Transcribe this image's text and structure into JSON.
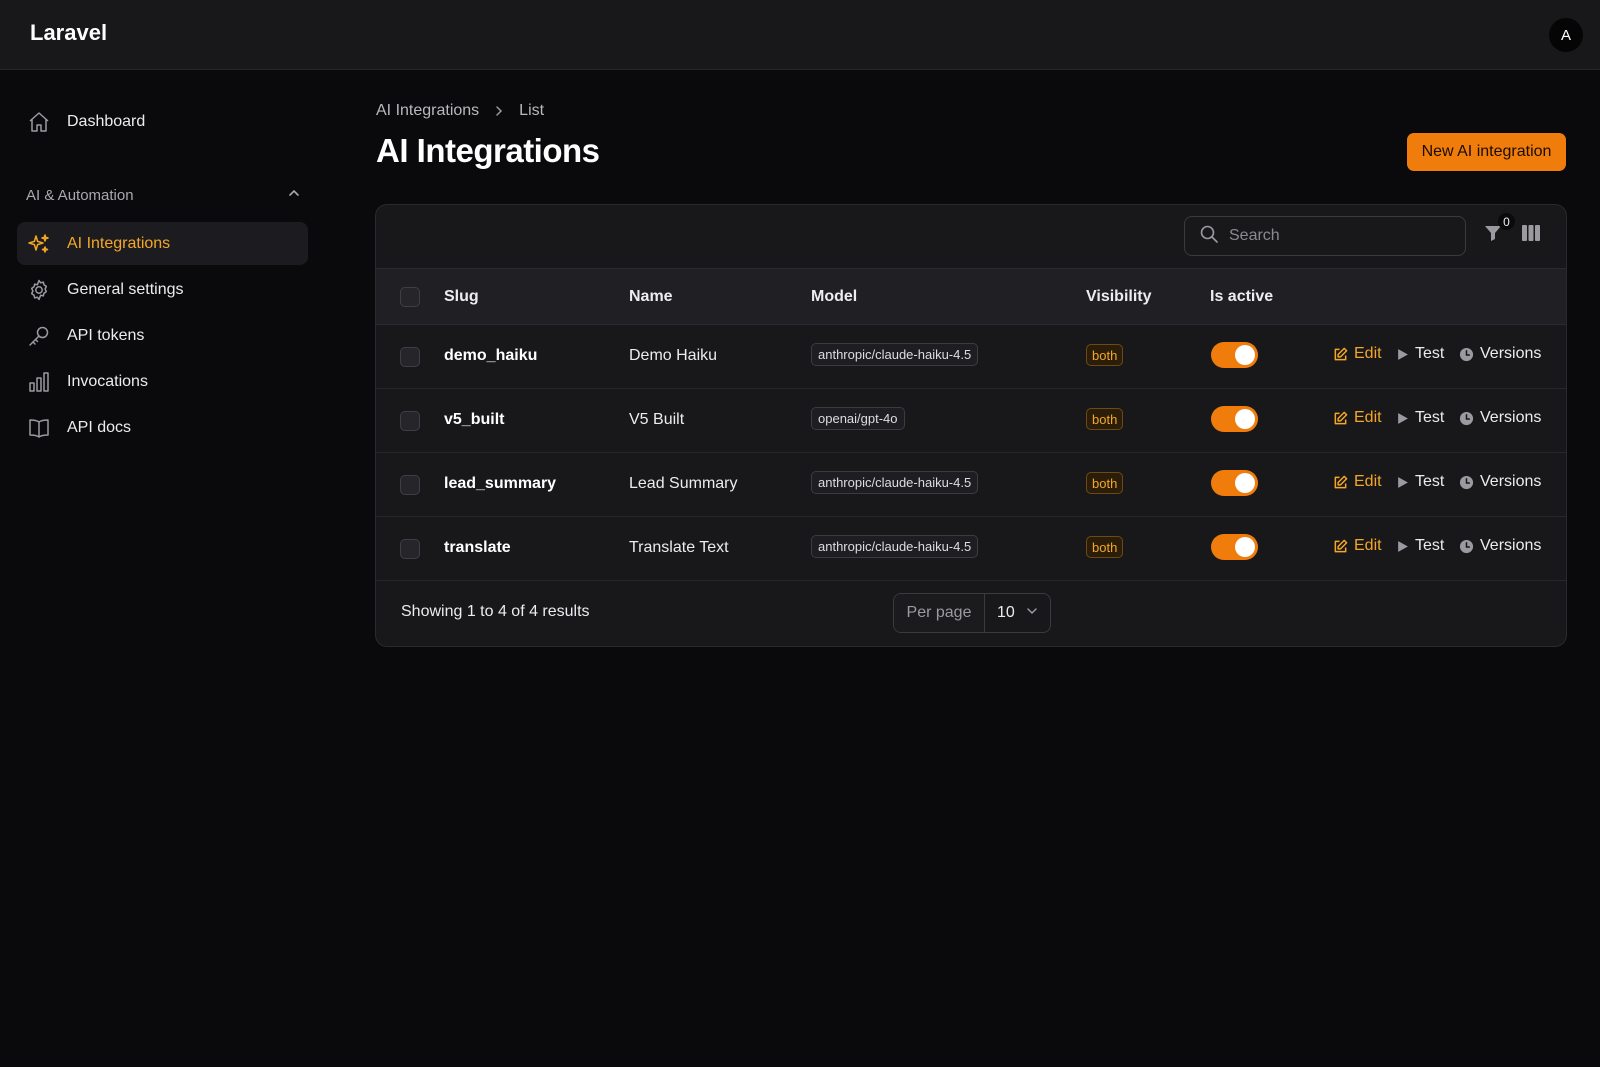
{
  "app": {
    "brand": "Laravel",
    "user_initial": "A"
  },
  "sidebar": {
    "dashboard": "Dashboard",
    "group_label": "AI & Automation",
    "items": [
      {
        "label": "AI Integrations",
        "icon": "sparkles-icon",
        "active": true
      },
      {
        "label": "General settings",
        "icon": "gear-icon",
        "active": false
      },
      {
        "label": "API tokens",
        "icon": "key-icon",
        "active": false
      },
      {
        "label": "Invocations",
        "icon": "bar-chart-icon",
        "active": false
      },
      {
        "label": "API docs",
        "icon": "book-open-icon",
        "active": false
      }
    ]
  },
  "breadcrumb": {
    "parent": "AI Integrations",
    "current": "List"
  },
  "page": {
    "title": "AI Integrations",
    "new_button": "New AI integration"
  },
  "toolbar": {
    "search_placeholder": "Search",
    "filter_count": "0"
  },
  "table": {
    "columns": {
      "slug": "Slug",
      "name": "Name",
      "model": "Model",
      "visibility": "Visibility",
      "is_active": "Is active"
    },
    "rows": [
      {
        "slug": "demo_haiku",
        "name": "Demo Haiku",
        "model": "anthropic/claude-haiku-4.5",
        "visibility": "both",
        "active": true
      },
      {
        "slug": "v5_built",
        "name": "V5 Built",
        "model": "openai/gpt-4o",
        "visibility": "both",
        "active": true
      },
      {
        "slug": "lead_summary",
        "name": "Lead Summary",
        "model": "anthropic/claude-haiku-4.5",
        "visibility": "both",
        "active": true
      },
      {
        "slug": "translate",
        "name": "Translate Text",
        "model": "anthropic/claude-haiku-4.5",
        "visibility": "both",
        "active": true
      }
    ],
    "actions": {
      "edit": "Edit",
      "test": "Test",
      "versions": "Versions"
    }
  },
  "footer": {
    "showing": "Showing 1 to 4 of 4 results",
    "per_page_label": "Per page",
    "per_page_value": "10"
  },
  "colors": {
    "accent": "#f07c0c",
    "accent_text": "#f4a724",
    "background": "#0a0a0c",
    "surface": "#18181b"
  }
}
